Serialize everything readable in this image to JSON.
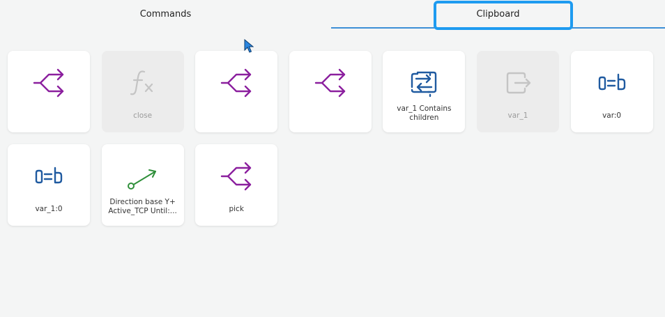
{
  "tabs": {
    "commands": "Commands",
    "clipboard": "Clipboard"
  },
  "colors": {
    "accent": "#3d8fd6",
    "focus": "#1e9bf0",
    "branch": "#8b1f9e",
    "blue": "#1f5aa0",
    "green": "#2f8f3a",
    "disabled": "#c4c4c4"
  },
  "cards": [
    {
      "icon": "branch-icon",
      "label": "",
      "disabled": false
    },
    {
      "icon": "function-icon",
      "label": "close",
      "disabled": true
    },
    {
      "icon": "branch-icon",
      "label": "",
      "disabled": false
    },
    {
      "icon": "branch-icon",
      "label": "",
      "disabled": false
    },
    {
      "icon": "swap-icon",
      "label": "var_1 Contains children",
      "disabled": false
    },
    {
      "icon": "exit-arrow-icon",
      "label": "var_1",
      "disabled": true
    },
    {
      "icon": "assign-icon",
      "label": "var:0",
      "disabled": false
    },
    {
      "icon": "assign-icon",
      "label": "var_1:0",
      "disabled": false
    },
    {
      "icon": "direction-icon",
      "label": "Direction base Y+ Active_TCP Until:...",
      "disabled": false
    },
    {
      "icon": "branch-icon",
      "label": "pick",
      "disabled": false
    }
  ]
}
